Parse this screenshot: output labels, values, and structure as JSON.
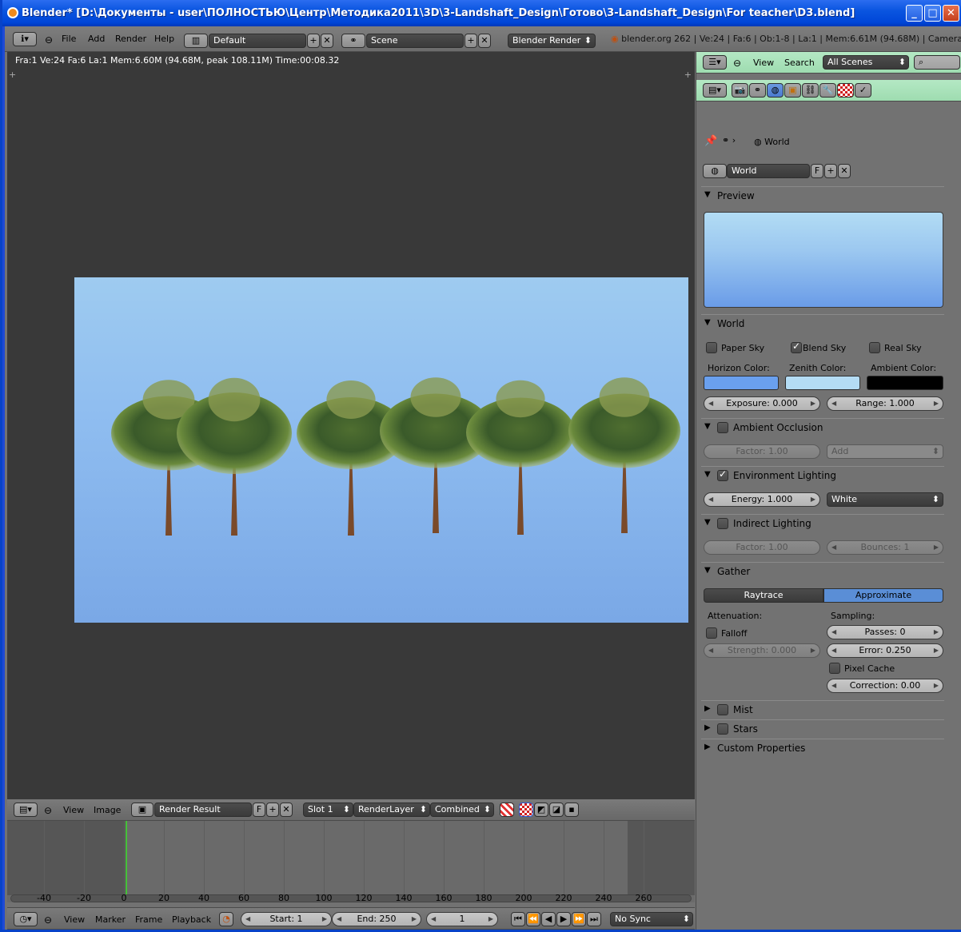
{
  "window": {
    "title": "Blender* [D:\\Документы - user\\ПОЛНОСТЬЮ\\Центр\\Методика2011\\3D\\3-Landshaft_Design\\Готово\\3-Landshaft_Design\\For teacher\\D3.blend]"
  },
  "topmenu": {
    "file": "File",
    "add": "Add",
    "render": "Render",
    "help": "Help",
    "layout": "Default",
    "scene": "Scene",
    "engine": "Blender Render",
    "info": "blender.org 262 | Ve:24 | Fa:6 | Ob:1-8 | La:1 | Mem:6.61M (94.68M) | Camera"
  },
  "viewport": {
    "status": "Fra:1  Ve:24 Fa:6 La:1 Mem:6.60M (94.68M, peak 108.11M) Time:00:08.32"
  },
  "image_header": {
    "view": "View",
    "image": "Image",
    "image_name": "Render Result",
    "fake": "F",
    "slot": "Slot 1",
    "layer": "RenderLayer",
    "pass": "Combined"
  },
  "outliner": {
    "view": "View",
    "search": "Search",
    "scenes": "All Scenes"
  },
  "props": {
    "breadcrumb": "World",
    "datablock": "World",
    "fake": "F",
    "preview": "Preview",
    "world_panel": "World",
    "paper_sky": "Paper Sky",
    "blend_sky": "Blend Sky",
    "real_sky": "Real Sky",
    "horizon": "Horizon Color:",
    "zenith": "Zenith Color:",
    "ambient": "Ambient Color:",
    "exposure": "Exposure: 0.000",
    "range": "Range: 1.000",
    "ao": "Ambient Occlusion",
    "ao_factor": "Factor: 1.00",
    "ao_mode": "Add",
    "env": "Environment Lighting",
    "env_energy": "Energy: 1.000",
    "env_color": "White",
    "indirect": "Indirect Lighting",
    "ind_factor": "Factor: 1.00",
    "ind_bounces": "Bounces: 1",
    "gather": "Gather",
    "raytrace": "Raytrace",
    "approximate": "Approximate",
    "attenuation": "Attenuation:",
    "sampling": "Sampling:",
    "falloff": "Falloff",
    "strength": "Strength: 0.000",
    "passes": "Passes: 0",
    "error": "Error: 0.250",
    "pixel_cache": "Pixel Cache",
    "correction": "Correction: 0.00",
    "mist": "Mist",
    "stars": "Stars",
    "custom": "Custom Properties"
  },
  "colors": {
    "horizon": "#6aa0ee",
    "zenith": "#b4dcf4",
    "ambient": "#000000",
    "accent": "#5a8ed6"
  },
  "timeline": {
    "labels": [
      "-40",
      "-20",
      "0",
      "20",
      "40",
      "60",
      "80",
      "100",
      "120",
      "140",
      "160",
      "180",
      "200",
      "220",
      "240",
      "260"
    ],
    "current_frame": 0
  },
  "timeline_header": {
    "view": "View",
    "marker": "Marker",
    "frame": "Frame",
    "playback": "Playback",
    "start": "Start: 1",
    "end": "End: 250",
    "current": "1",
    "sync": "No Sync"
  }
}
